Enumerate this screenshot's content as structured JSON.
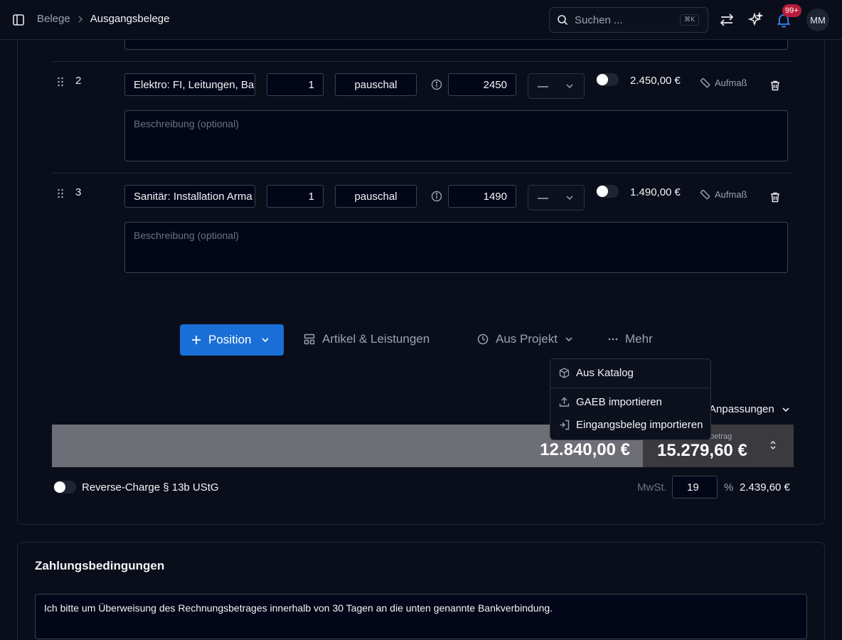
{
  "header": {
    "breadcrumb_parent": "Belege",
    "breadcrumb_current": "Ausgangsbelege",
    "search_placeholder": "Suchen ...",
    "search_shortcut": "⌘K",
    "notification_count": "99+",
    "avatar_initials": "MM"
  },
  "positions": [
    {
      "number": "2",
      "title": "Elektro: FI, Leitungen, Ba",
      "quantity": "1",
      "unit": "pauschal",
      "price": "2450",
      "tax_select": "—",
      "total": "2.450,00 €",
      "measure_label": "Aufmaß",
      "description_placeholder": "Beschreibung (optional)"
    },
    {
      "number": "3",
      "title": "Sanitär: Installation Arma",
      "quantity": "1",
      "unit": "pauschal",
      "price": "1490",
      "tax_select": "—",
      "total": "1.490,00 €",
      "measure_label": "Aufmaß",
      "description_placeholder": "Beschreibung (optional)"
    }
  ],
  "actions": {
    "position_label": "Position",
    "articles_label": "Artikel & Leistungen",
    "from_project_label": "Aus Projekt",
    "more_label": "Mehr"
  },
  "menu": {
    "items": [
      {
        "label": "Aus Katalog",
        "icon": "package-icon"
      },
      {
        "label": "GAEB importieren",
        "icon": "upload-icon"
      },
      {
        "label": "Eingangsbeleg importieren",
        "icon": "import-icon"
      }
    ]
  },
  "totals": {
    "adjustments_label": "Anpassungen",
    "net_amount": "12.840,00 €",
    "gross_label": "betrag",
    "gross_amount": "15.279,60 €",
    "reverse_charge_label": "Reverse-Charge § 13b UStG",
    "vat_label": "MwSt.",
    "vat_rate": "19",
    "vat_percent_sign": "%",
    "vat_amount": "2.439,60 €"
  },
  "payment": {
    "title": "Zahlungsbedingungen",
    "text": "Ich bitte um Überweisung des Rechnungsbetrages innerhalb von 30 Tagen an die unten genannte Bankverbindung."
  },
  "colors": {
    "primary": "#1a6fd6",
    "background": "#0a0e1a",
    "badge": "#b91c3c"
  }
}
